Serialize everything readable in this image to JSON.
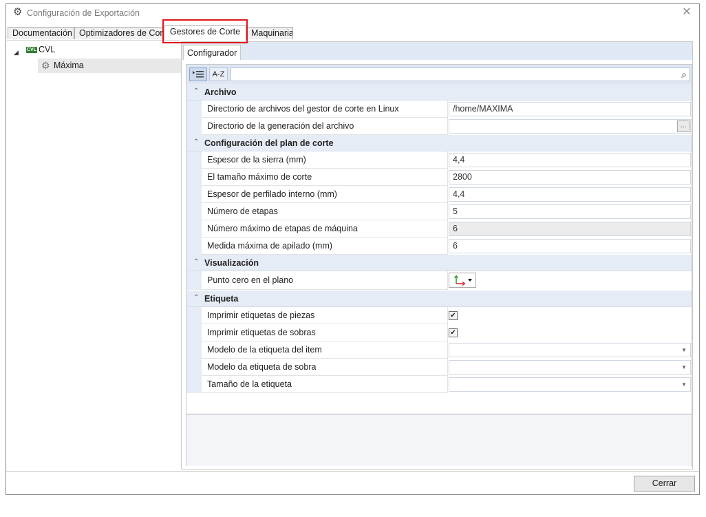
{
  "window": {
    "title": "Configuración de Exportación"
  },
  "tabs": [
    {
      "label": "Documentación"
    },
    {
      "label": "Optimizadores de Corte"
    },
    {
      "label": "Gestores de Corte"
    },
    {
      "label": "Maquinaria"
    }
  ],
  "tree": {
    "root": {
      "label": "CVL",
      "icon_text": "CVL",
      "icon": "cvl-icon"
    },
    "child": {
      "label": "Máxima",
      "icon": "gear-icon"
    }
  },
  "subtab": {
    "label": "Configurador"
  },
  "toolbar": {
    "categorized_icon": "categorized-icon",
    "az_label": "A-Z",
    "search_value": ""
  },
  "categories": {
    "archivo": {
      "label": "Archivo"
    },
    "plan": {
      "label": "Configuración del plan de corte"
    },
    "visual": {
      "label": "Visualización"
    },
    "etiqueta": {
      "label": "Etiqueta"
    }
  },
  "props": {
    "dir_linux": {
      "name": "Directorio de archivos del gestor de corte en Linux",
      "value": "/home/MAXIMA"
    },
    "dir_gen": {
      "name": "Directorio de la generación del archivo",
      "value": "",
      "button": "..."
    },
    "espesor_sierra": {
      "name": "Espesor de la sierra (mm)",
      "value": "4,4"
    },
    "tamano_max": {
      "name": "El tamaño máximo de corte",
      "value": "2800"
    },
    "espesor_perfilado": {
      "name": "Espesor de perfilado interno (mm)",
      "value": "4,4"
    },
    "num_etapas": {
      "name": "Número de etapas",
      "value": "5"
    },
    "num_max_etapas": {
      "name": "Número máximo de etapas de máquina",
      "value": "6"
    },
    "medida_apilado": {
      "name": "Medida máxima de apilado (mm)",
      "value": "6"
    },
    "punto_cero": {
      "name": "Punto cero en el plano"
    },
    "imp_piezas": {
      "name": "Imprimir etiquetas de piezas",
      "checked": true
    },
    "imp_sobras": {
      "name": "Imprimir etiquetas de sobras",
      "checked": true
    },
    "modelo_item": {
      "name": "Modelo de la etiqueta del item",
      "value": ""
    },
    "modelo_sobra": {
      "name": "Modelo da etiqueta de sobra",
      "value": ""
    },
    "tamano_etiqueta": {
      "name": "Tamaño de la etiqueta",
      "value": ""
    }
  },
  "footer": {
    "close_label": "Cerrar"
  },
  "colors": {
    "highlight": "#e0161b",
    "category_bg": "#e6ecf6",
    "cvl_green": "#2e7d32"
  }
}
